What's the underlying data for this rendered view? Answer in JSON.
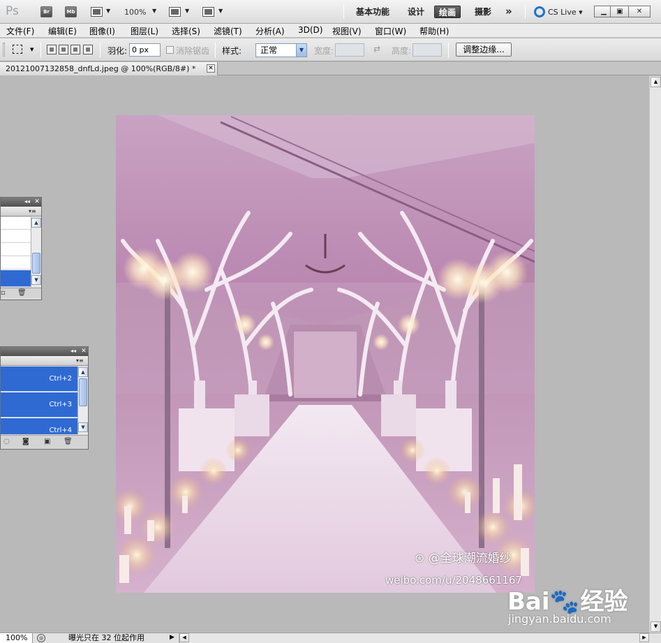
{
  "appbar": {
    "logo": "Ps",
    "bridge": "Br",
    "minibridge": "Mb",
    "zoom": "100%",
    "workspaces": [
      "基本功能",
      "设计",
      "绘画",
      "摄影"
    ],
    "active_workspace": "绘画",
    "more": "»",
    "cslive": "CS Live"
  },
  "menu": [
    "文件(F)",
    "编辑(E)",
    "图像(I)",
    "图层(L)",
    "选择(S)",
    "滤镜(T)",
    "分析(A)",
    "3D(D)",
    "视图(V)",
    "窗口(W)",
    "帮助(H)"
  ],
  "options": {
    "feather_label": "羽化:",
    "feather_value": "0 px",
    "antialias_label": "消除锯齿",
    "style_label": "样式:",
    "style_value": "正常",
    "width_label": "宽度:",
    "height_label": "高度:",
    "refine_edge": "调整边缘..."
  },
  "document": {
    "tab_title": "20121007132858_dnfLd.jpeg @ 100%(RGB/8#) *",
    "close": "✕"
  },
  "photo": {
    "weibo_handle": "@全球潮流婚纱",
    "weibo_url": "weibo.com/u/2048661167"
  },
  "baidu": {
    "logo_left": "Bai",
    "logo_right": "经验",
    "site": "jingyan.baidu.com"
  },
  "panel2": {
    "shortcuts": [
      "Ctrl+2",
      "Ctrl+3",
      "Ctrl+4"
    ]
  },
  "status": {
    "zoom": "100%",
    "message": "曝光只在 32 位起作用"
  }
}
